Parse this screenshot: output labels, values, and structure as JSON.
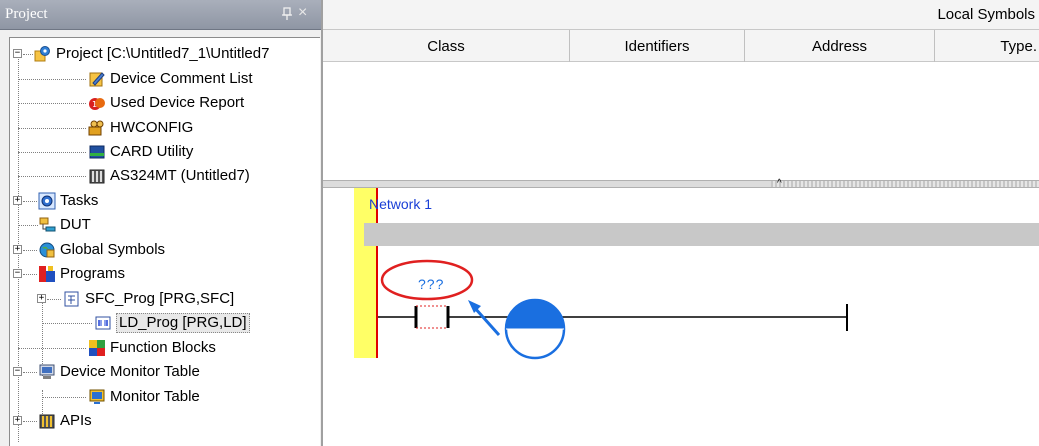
{
  "project_panel": {
    "title": "Project",
    "pin_icon": "pin-icon",
    "close_icon": "close-icon",
    "close_glyph": "×"
  },
  "tree": {
    "items": [
      {
        "label": "Project [C:\\Untitled7_1\\Untitled7",
        "icon": "project-gear-icon",
        "expander": "−"
      },
      {
        "label": "Device Comment List",
        "icon": "comment-list-icon"
      },
      {
        "label": "Used Device Report",
        "icon": "device-report-icon"
      },
      {
        "label": "HWCONFIG",
        "icon": "hwconfig-icon"
      },
      {
        "label": "CARD Utility",
        "icon": "card-utility-icon"
      },
      {
        "label": "AS324MT  (Untitled7)",
        "icon": "plc-icon"
      },
      {
        "label": "Tasks",
        "icon": "tasks-icon",
        "expander": "+"
      },
      {
        "label": "DUT",
        "icon": "dut-icon"
      },
      {
        "label": "Global Symbols",
        "icon": "global-symbols-icon",
        "expander": "+"
      },
      {
        "label": "Programs",
        "icon": "programs-icon",
        "expander": "−"
      },
      {
        "label": "SFC_Prog [PRG,SFC]",
        "icon": "sfc-program-icon",
        "expander": "+"
      },
      {
        "label": "LD_Prog [PRG,LD]",
        "icon": "ld-program-icon",
        "selected": true
      },
      {
        "label": "Function Blocks",
        "icon": "function-blocks-icon"
      },
      {
        "label": "Device Monitor Table",
        "icon": "device-monitor-icon",
        "expander": "−"
      },
      {
        "label": "Monitor Table",
        "icon": "monitor-table-icon"
      },
      {
        "label": "APIs",
        "icon": "apis-icon",
        "expander": "+"
      }
    ]
  },
  "local_symbols": {
    "title": "Local Symbols",
    "columns": [
      "Class",
      "Identifiers",
      "Address",
      "Type."
    ]
  },
  "editor": {
    "network_label": "Network 1",
    "contact_placeholder": "???",
    "colors": {
      "rail_yellow": "#ffff66",
      "rail_red": "#e00000",
      "network_label": "#1a3fd6",
      "highlight_circle": "#e02020",
      "annotation_blue": "#1a6fe0"
    },
    "annotation": {
      "mouse_icon": "mouse-left-click-icon",
      "arrow_icon": "arrow-icon"
    }
  }
}
